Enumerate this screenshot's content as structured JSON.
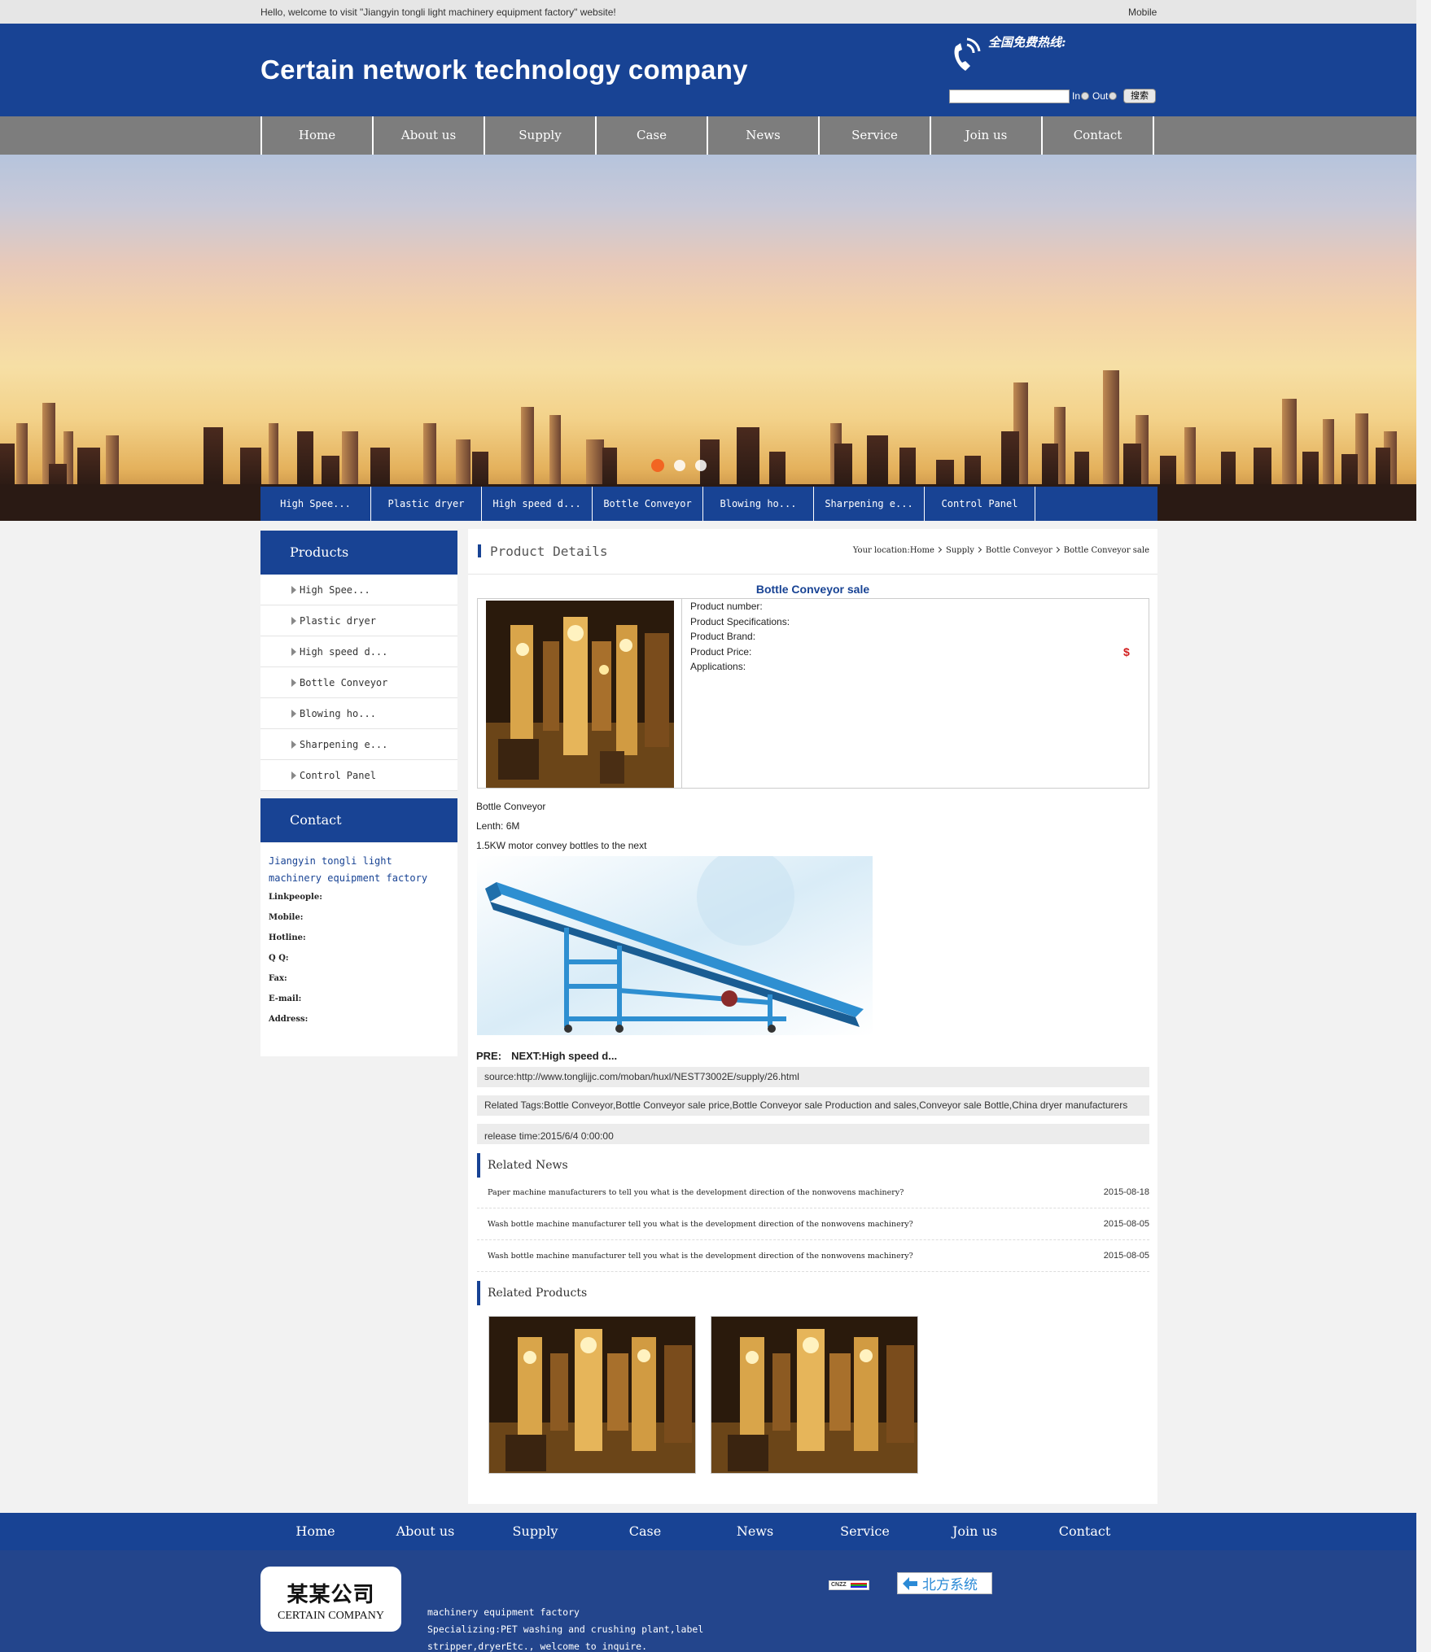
{
  "topbar": {
    "welcome": "Hello, welcome to visit \"Jiangyin tongli light machinery equipment factory\" website!",
    "mobile": "Mobile"
  },
  "header": {
    "logo_text": "Certain network technology company",
    "hotline": "全国免费热线:",
    "search": {
      "input_value": "",
      "radio_in": "In",
      "radio_out": "Out",
      "button": "搜索"
    }
  },
  "nav": [
    "Home",
    "About us",
    "Supply",
    "Case",
    "News",
    "Service",
    "Join us",
    "Contact"
  ],
  "banner": {
    "slide_count": 3,
    "active_slide": 1
  },
  "categories": [
    "High Spee...",
    "Plastic dryer",
    "High speed d...",
    "Bottle Conveyor",
    "Blowing ho...",
    "Sharpening e...",
    "Control Panel"
  ],
  "sidebar": {
    "products_title": "Products",
    "products": [
      "High Spee...",
      "Plastic dryer",
      "High speed d...",
      "Bottle Conveyor",
      "Blowing ho...",
      "Sharpening e...",
      "Control Panel"
    ],
    "contact_title": "Contact",
    "contact": {
      "company": "Jiangyin tongli light machinery equipment factory",
      "linkpeople": "Linkpeople:",
      "mobile": "Mobile:",
      "hotline": "Hotline:",
      "qq": "Q Q:",
      "fax": "Fax:",
      "email": "E-mail:",
      "address": "Address:"
    }
  },
  "main": {
    "section_title": "Product Details",
    "breadcrumb": {
      "prefix": "Your location:",
      "items": [
        "Home",
        "Supply",
        "Bottle Conveyor",
        "Bottle Conveyor sale"
      ]
    },
    "product": {
      "title": "Bottle Conveyor sale",
      "number_label": "Product number:",
      "spec_label": "Product Specifications:",
      "brand_label": "Product Brand:",
      "price_label": "Product Price:",
      "price_symbol": "$",
      "applications_label": "Applications:"
    },
    "description": [
      "Bottle Conveyor",
      "Lenth: 6M",
      "1.5KW motor convey bottles to the next"
    ],
    "prev": "PRE:",
    "next": "NEXT:High speed d...",
    "source": "source:http://www.tonglijjc.com/moban/huxl/NEST73002E/supply/26.html",
    "tags": "Related Tags:Bottle Conveyor,Bottle Conveyor sale price,Bottle Conveyor sale Production and sales,Conveyor sale Bottle,China dryer manufacturers",
    "release": "release time:2015/6/4 0:00:00",
    "related_news_title": "Related News",
    "related_news": [
      {
        "title": "Paper machine manufacturers to tell you what is the development direction of the nonwovens machinery?",
        "date": "2015-08-18"
      },
      {
        "title": "Wash bottle machine manufacturer tell you what is the development direction of the nonwovens machinery?",
        "date": "2015-08-05"
      },
      {
        "title": "Wash bottle machine manufacturer tell you what is the development direction of the nonwovens machinery?",
        "date": "2015-08-05"
      }
    ],
    "related_products_title": "Related Products"
  },
  "footer": {
    "nav": [
      "Home",
      "About us",
      "Supply",
      "Case",
      "News",
      "Service",
      "Join us",
      "Contact"
    ],
    "logo_cn": "某某公司",
    "logo_en": "CERTAIN COMPANY",
    "text_lines": [
      "machinery equipment factory",
      "Specializing:PET washing and crushing plant,label",
      "stripper,dryerEtc., welcome to inquire."
    ],
    "badge1": "CNZZ",
    "badge2": "北方系统"
  },
  "colors": {
    "brand_blue": "#184394",
    "nav_gray": "#7d7d7d",
    "price_red": "#d21f1f",
    "active_dot": "#f26522"
  }
}
